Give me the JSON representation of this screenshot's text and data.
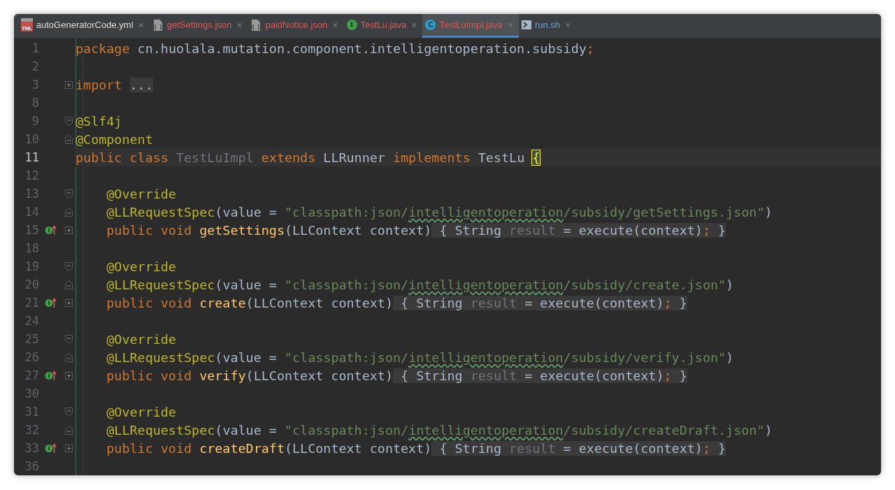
{
  "tabs": [
    {
      "label": "autoGeneratorCode.yml",
      "kind": "yml",
      "badge": "YML",
      "color": "#dcdcdc",
      "selected": false,
      "close": "×"
    },
    {
      "label": "getSettings.json",
      "kind": "json",
      "color": "#e05555",
      "selected": false,
      "close": "×"
    },
    {
      "label": "paidNotice.json",
      "kind": "json",
      "color": "#e05555",
      "selected": false,
      "close": "×"
    },
    {
      "label": "TestLu.java",
      "kind": "interface",
      "badge": "I",
      "color": "#e05555",
      "selected": false,
      "close": "×"
    },
    {
      "label": "TestLuImpl.java",
      "kind": "class",
      "badge": "C",
      "color": "#e05555",
      "selected": true,
      "close": "×"
    },
    {
      "label": "run.sh",
      "kind": "shell",
      "color": "#6e9fd6",
      "selected": false,
      "close": "×"
    }
  ],
  "lines": [
    {
      "number": "1",
      "kind": "code",
      "tokens": [
        {
          "kind": "keyword",
          "text": "package"
        },
        {
          "kind": "plain",
          "text": " cn.huolala.mutation.component.intelligentoperation.subsidy"
        },
        {
          "kind": "keyword",
          "text": ";"
        }
      ]
    },
    {
      "number": "2",
      "kind": "code"
    },
    {
      "number": "3",
      "kind": "expandable",
      "tokens": [
        {
          "kind": "keyword",
          "text": "import "
        },
        {
          "kind": "folded",
          "text": "..."
        }
      ]
    },
    {
      "number": "8",
      "kind": "code"
    },
    {
      "number": "9",
      "kind": "start",
      "tokens": [
        {
          "kind": "annotation",
          "text": "@Slf4j"
        }
      ]
    },
    {
      "number": "10",
      "kind": "end",
      "tokens": [
        {
          "kind": "annotation",
          "text": "@Component"
        }
      ]
    },
    {
      "number": "11",
      "kind": "code",
      "current": true,
      "tokens": [
        {
          "kind": "keyword",
          "text": "public class "
        },
        {
          "kind": "unused",
          "text": "TestLuImpl"
        },
        {
          "kind": "keyword",
          "text": " extends "
        },
        {
          "kind": "plain",
          "text": "LLRunner"
        },
        {
          "kind": "keyword",
          "text": " implements "
        },
        {
          "kind": "plain",
          "text": "TestLu "
        },
        {
          "kind": "brace",
          "text": "{"
        }
      ]
    },
    {
      "number": "12",
      "kind": "code"
    },
    {
      "number": "13",
      "kind": "start",
      "tokens": [
        {
          "kind": "annotation",
          "text": "    @Override"
        }
      ]
    },
    {
      "number": "14",
      "kind": "end",
      "tokens": [
        {
          "kind": "annotation",
          "text": "    @LLRequestSpec"
        },
        {
          "kind": "plain",
          "text": "(value = "
        },
        {
          "kind": "string",
          "text": "\"classpath:json/"
        },
        {
          "kind": "typo",
          "text": "intelligentoperation"
        },
        {
          "kind": "string",
          "text": "/subsidy/getSettings.json\""
        },
        {
          "kind": "plain",
          "text": ")"
        }
      ]
    },
    {
      "number": "15",
      "kind": "expandable",
      "marker": true,
      "tokens": [
        {
          "kind": "keyword",
          "text": "    public void "
        },
        {
          "kind": "method",
          "text": "getSettings"
        },
        {
          "kind": "plain",
          "text": "(LLContext context)"
        },
        {
          "kind": "folded",
          "text": " { String "
        },
        {
          "kind": "folded-unused",
          "text": "result"
        },
        {
          "kind": "folded",
          "text": " = execute(context)"
        },
        {
          "kind": "folded-keyword",
          "text": ";"
        },
        {
          "kind": "folded",
          "text": " }"
        }
      ]
    },
    {
      "number": "18",
      "kind": "code"
    },
    {
      "number": "19",
      "kind": "start",
      "tokens": [
        {
          "kind": "annotation",
          "text": "    @Override"
        }
      ]
    },
    {
      "number": "20",
      "kind": "end",
      "tokens": [
        {
          "kind": "annotation",
          "text": "    @LLRequestSpec"
        },
        {
          "kind": "plain",
          "text": "(value = "
        },
        {
          "kind": "string",
          "text": "\"classpath:json/"
        },
        {
          "kind": "typo",
          "text": "intelligentoperation"
        },
        {
          "kind": "string",
          "text": "/subsidy/create.json\""
        },
        {
          "kind": "plain",
          "text": ")"
        }
      ]
    },
    {
      "number": "21",
      "kind": "expandable",
      "marker": true,
      "tokens": [
        {
          "kind": "keyword",
          "text": "    public void "
        },
        {
          "kind": "method",
          "text": "create"
        },
        {
          "kind": "plain",
          "text": "(LLContext context)"
        },
        {
          "kind": "folded",
          "text": " { String "
        },
        {
          "kind": "folded-unused",
          "text": "result"
        },
        {
          "kind": "folded",
          "text": " = execute(context)"
        },
        {
          "kind": "folded-keyword",
          "text": ";"
        },
        {
          "kind": "folded",
          "text": " }"
        }
      ]
    },
    {
      "number": "24",
      "kind": "code"
    },
    {
      "number": "25",
      "kind": "start",
      "tokens": [
        {
          "kind": "annotation",
          "text": "    @Override"
        }
      ]
    },
    {
      "number": "26",
      "kind": "end",
      "tokens": [
        {
          "kind": "annotation",
          "text": "    @LLRequestSpec"
        },
        {
          "kind": "plain",
          "text": "(value = "
        },
        {
          "kind": "string",
          "text": "\"classpath:json/"
        },
        {
          "kind": "typo",
          "text": "intelligentoperation"
        },
        {
          "kind": "string",
          "text": "/subsidy/verify.json\""
        },
        {
          "kind": "plain",
          "text": ")"
        }
      ]
    },
    {
      "number": "27",
      "kind": "expandable",
      "marker": true,
      "tokens": [
        {
          "kind": "keyword",
          "text": "    public void "
        },
        {
          "kind": "method",
          "text": "verify"
        },
        {
          "kind": "plain",
          "text": "(LLContext context)"
        },
        {
          "kind": "folded",
          "text": " { String "
        },
        {
          "kind": "folded-unused",
          "text": "result"
        },
        {
          "kind": "folded",
          "text": " = execute(context)"
        },
        {
          "kind": "folded-keyword",
          "text": ";"
        },
        {
          "kind": "folded",
          "text": " }"
        }
      ]
    },
    {
      "number": "30",
      "kind": "code"
    },
    {
      "number": "31",
      "kind": "start",
      "tokens": [
        {
          "kind": "annotation",
          "text": "    @Override"
        }
      ]
    },
    {
      "number": "32",
      "kind": "end",
      "tokens": [
        {
          "kind": "annotation",
          "text": "    @LLRequestSpec"
        },
        {
          "kind": "plain",
          "text": "(value = "
        },
        {
          "kind": "string",
          "text": "\"classpath:json/"
        },
        {
          "kind": "typo",
          "text": "intelligentoperation"
        },
        {
          "kind": "string",
          "text": "/subsidy/createDraft.json\""
        },
        {
          "kind": "plain",
          "text": ")"
        }
      ]
    },
    {
      "number": "33",
      "kind": "expandable",
      "marker": true,
      "tokens": [
        {
          "kind": "keyword",
          "text": "    public void "
        },
        {
          "kind": "method",
          "text": "createDraft"
        },
        {
          "kind": "plain",
          "text": "(LLContext context)"
        },
        {
          "kind": "folded",
          "text": " { String "
        },
        {
          "kind": "folded-unused",
          "text": "result"
        },
        {
          "kind": "folded",
          "text": " = execute(context)"
        },
        {
          "kind": "folded-keyword",
          "text": ";"
        },
        {
          "kind": "folded",
          "text": " }"
        }
      ]
    },
    {
      "number": "36",
      "kind": "code"
    }
  ]
}
